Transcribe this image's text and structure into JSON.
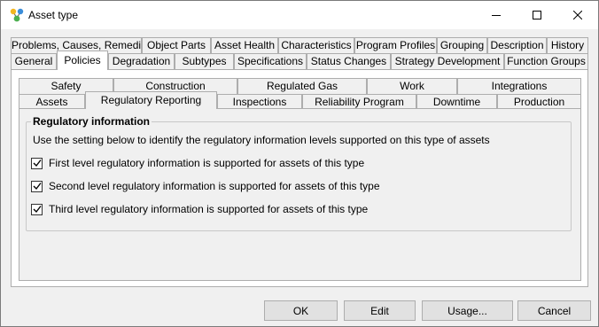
{
  "window": {
    "title": "Asset type",
    "controls": [
      "minimize-icon",
      "maximize-icon",
      "close-icon"
    ]
  },
  "tabs_row1": [
    "Problems, Causes, Remedies",
    "Object Parts",
    "Asset Health",
    "Characteristics",
    "Program Profiles",
    "Grouping",
    "Description",
    "History"
  ],
  "tabs_row2": [
    "General",
    "Policies",
    "Degradation",
    "Subtypes",
    "Specifications",
    "Status Changes",
    "Strategy Development",
    "Function Groups"
  ],
  "selected_tab": "Policies",
  "subtabs_row1": [
    "Safety",
    "Construction",
    "Regulated Gas",
    "Work",
    "Integrations"
  ],
  "subtabs_row2": [
    "Assets",
    "Regulatory Reporting",
    "Inspections",
    "Reliability Program",
    "Downtime",
    "Production"
  ],
  "selected_subtab": "Regulatory Reporting",
  "group": {
    "title": "Regulatory  information",
    "description": "Use the setting below to identify the regulatory information levels supported on this type of assets",
    "checkboxes": [
      {
        "label": "First level regulatory information is supported for assets of this type",
        "checked": true
      },
      {
        "label": "Second level regulatory information is supported for assets of this type",
        "checked": true
      },
      {
        "label": "Third level regulatory information is supported for assets of this type",
        "checked": true
      }
    ]
  },
  "buttons": [
    "OK",
    "Edit",
    "Usage...",
    "Cancel"
  ]
}
